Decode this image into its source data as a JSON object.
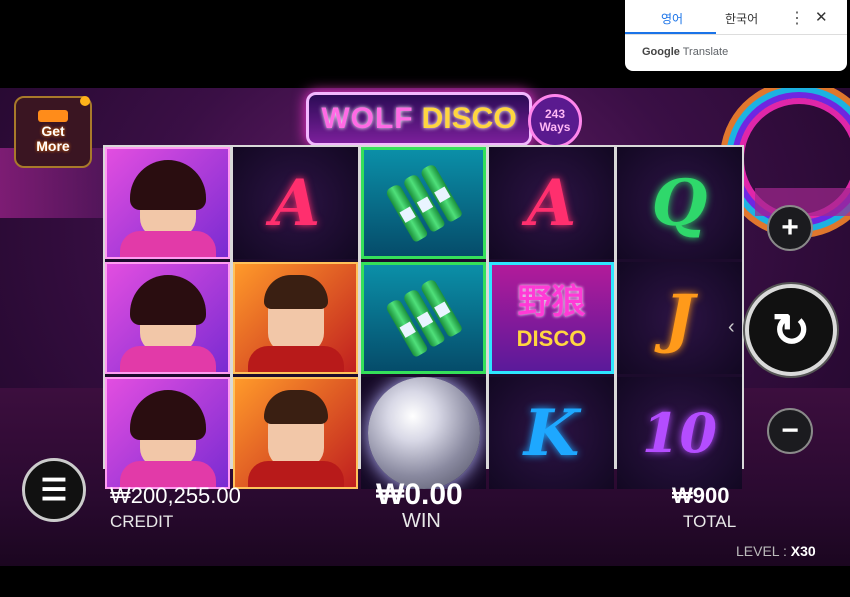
{
  "translate_popup": {
    "tab_english": "영어",
    "tab_korean": "한국어",
    "more_icon": "⋮",
    "close_icon": "✕",
    "brand_google": "Google",
    "brand_translate": "Translate"
  },
  "game": {
    "logo_word1": "WOLF",
    "logo_word2": "DISCO",
    "ways_count": "243",
    "ways_label": "Ways",
    "get_more_1": "Get",
    "get_more_2": "More",
    "reels": [
      [
        "lady",
        "lady",
        "lady"
      ],
      [
        "A",
        "man",
        "man"
      ],
      [
        "bottle",
        "bottle",
        "discoball"
      ],
      [
        "A",
        "wolf",
        "K"
      ],
      [
        "Q",
        "J",
        "10"
      ]
    ],
    "wolf_symbol_chinese": "野狼",
    "wolf_symbol_text": "DISCO",
    "credit_value": "₩200,255.00",
    "credit_label": "CREDIT",
    "win_value": "₩0.00",
    "win_label": "WIN",
    "total_value": "₩900",
    "total_label": "TOTAL",
    "level_label": "LEVEL :",
    "level_value": "X30",
    "plus_icon": "+",
    "minus_icon": "−",
    "spin_icon": "↻",
    "menu_icon": "☰",
    "spin_arrow_icon": "‹"
  }
}
